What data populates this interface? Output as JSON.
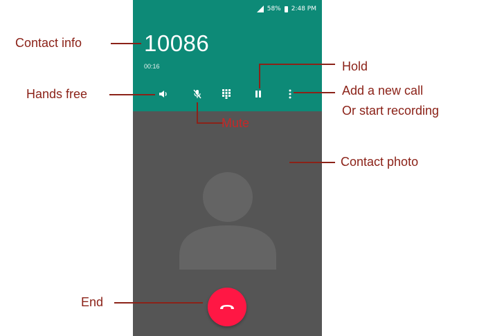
{
  "status": {
    "battery": "58%",
    "time": "2:48 PM"
  },
  "call": {
    "number": "10086",
    "duration": "00:16"
  },
  "annotations": {
    "contact_info": "Contact info",
    "hands_free": "Hands free",
    "hold": "Hold",
    "add_call": "Add a new call",
    "start_recording": "Or start recording",
    "mute": "Mute",
    "contact_photo": "Contact photo",
    "end": "End"
  },
  "colors": {
    "header": "#0d8a77",
    "body": "#555555",
    "end_button": "#ff1744",
    "annotation": "#8b2218"
  },
  "icons": [
    "speaker-icon",
    "mute-mic-icon",
    "dialpad-icon",
    "pause-icon",
    "more-vert-icon",
    "end-call-icon",
    "avatar-icon"
  ]
}
